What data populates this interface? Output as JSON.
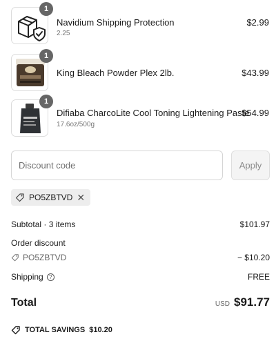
{
  "line_items": [
    {
      "title": "Navidium Shipping Protection",
      "subtitle": "2.25",
      "price": "$2.99",
      "quantity": "1",
      "image_icon": "shield-box-icon"
    },
    {
      "title": "King Bleach Powder Plex 2lb.",
      "subtitle": "",
      "price": "$43.99",
      "quantity": "1",
      "image_icon": "product-tub-image"
    },
    {
      "title": "Difiaba CharcoLite Cool Toning Lightening Paste",
      "subtitle": "17.6oz/500g",
      "price": "$54.99",
      "quantity": "1",
      "image_icon": "product-pouch-image"
    }
  ],
  "discount": {
    "placeholder": "Discount code",
    "apply_label": "Apply",
    "applied_code": "PO5ZBTVD"
  },
  "summary": {
    "subtotal_label": "Subtotal · 3 items",
    "subtotal_value": "$101.97",
    "order_discount_label": "Order discount",
    "discount_code": "PO5ZBTVD",
    "discount_value": "− $10.20",
    "shipping_label": "Shipping",
    "shipping_value": "FREE",
    "total_label": "Total",
    "currency": "USD",
    "total_value": "$91.77",
    "savings_label": "TOTAL SAVINGS",
    "savings_value": "$10.20"
  },
  "colors": {
    "qty_badge": "#666666",
    "chip_background": "#ededed",
    "apply_disabled": "#f4f4f4"
  }
}
